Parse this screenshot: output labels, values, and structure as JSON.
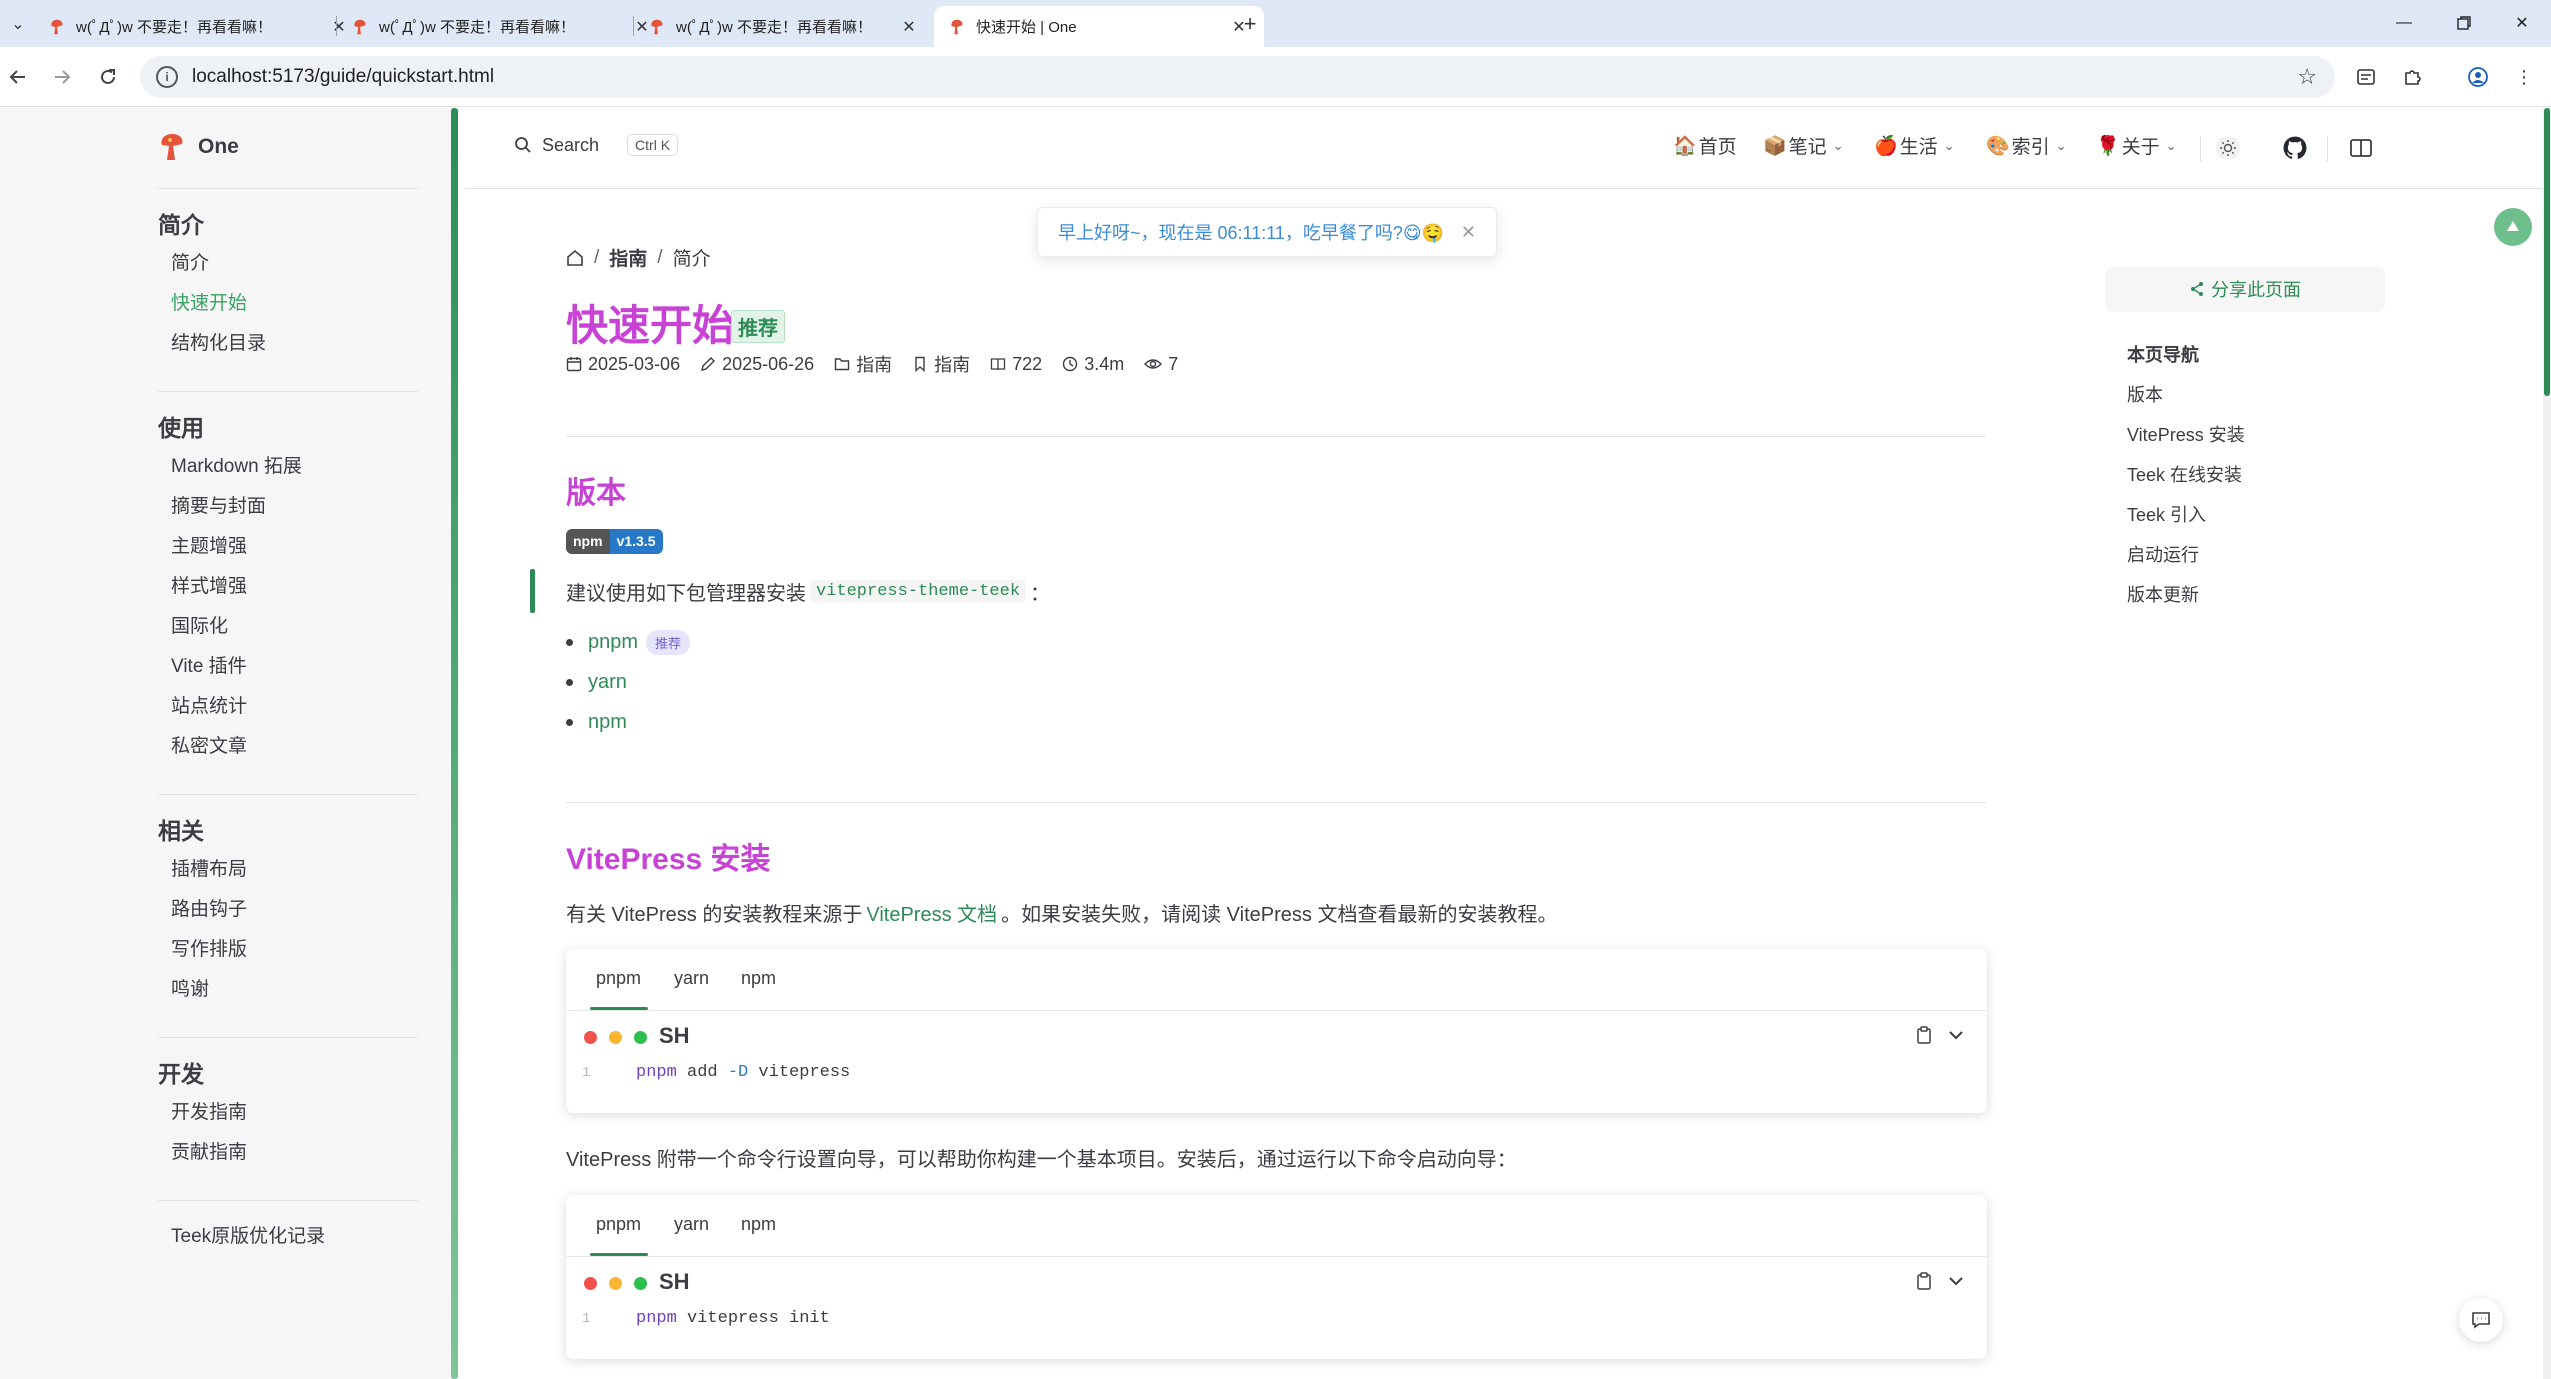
{
  "browser": {
    "tabs": [
      {
        "title": "w(ﾟДﾟ)w 不要走！再看看嘛！",
        "active": false
      },
      {
        "title": "w(ﾟДﾟ)w 不要走！再看看嘛！",
        "active": false
      },
      {
        "title": "w(ﾟДﾟ)w 不要走！再看看嘛！",
        "active": false
      },
      {
        "title": "快速开始 | One",
        "active": true
      }
    ],
    "url": "localhost:5173/guide/quickstart.html"
  },
  "site": {
    "name": "One",
    "search_label": "Search",
    "search_shortcut": "Ctrl K"
  },
  "navbar": {
    "items": [
      {
        "emoji": "🏠",
        "label": "首页",
        "dropdown": false
      },
      {
        "emoji": "📦",
        "label": "笔记",
        "dropdown": true
      },
      {
        "emoji": "🍎",
        "label": "生活",
        "dropdown": true
      },
      {
        "emoji": "🎨",
        "label": "索引",
        "dropdown": true
      },
      {
        "emoji": "🌹",
        "label": "关于",
        "dropdown": true
      }
    ]
  },
  "toast": {
    "message": "早上好呀~，现在是 06:11:11，吃早餐了吗?😋🤤"
  },
  "sidebar": {
    "groups": [
      {
        "title": "简介",
        "items": [
          "简介",
          "快速开始",
          "结构化目录"
        ],
        "active": "快速开始"
      },
      {
        "title": "使用",
        "items": [
          "Markdown 拓展",
          "摘要与封面",
          "主题增强",
          "样式增强",
          "国际化",
          "Vite 插件",
          "站点统计",
          "私密文章"
        ]
      },
      {
        "title": "相关",
        "items": [
          "插槽布局",
          "路由钩子",
          "写作排版",
          "鸣谢"
        ]
      },
      {
        "title": "开发",
        "items": [
          "开发指南",
          "贡献指南"
        ]
      }
    ],
    "extra_item": "Teek原版优化记录"
  },
  "breadcrumb": {
    "items": [
      "指南",
      "简介"
    ]
  },
  "article": {
    "title": "快速开始",
    "badge": "推荐",
    "meta": {
      "created": "2025-03-06",
      "updated": "2025-06-26",
      "category": "指南",
      "tag": "指南",
      "word_count": "722",
      "reading_time": "3.4m",
      "views": "7"
    },
    "section_version": {
      "heading": "版本",
      "npm_badge_left": "npm",
      "npm_badge_right": "v1.3.5",
      "intro_before": "建议使用如下包管理器安装",
      "intro_code": "vitepress-theme-teek",
      "intro_after": "：",
      "managers": [
        {
          "name": "pnpm",
          "tag": "推荐"
        },
        {
          "name": "yarn",
          "tag": ""
        },
        {
          "name": "npm",
          "tag": ""
        }
      ]
    },
    "section_install": {
      "heading": "VitePress 安装",
      "intro_before": "有关 VitePress 的安装教程来源于",
      "intro_link": "VitePress 文档",
      "intro_after": "。如果安装失败，请阅读 VitePress 文档查看最新的安装教程。",
      "code_block_1": {
        "tabs": [
          "pnpm",
          "yarn",
          "npm"
        ],
        "active_tab": "pnpm",
        "lang": "SH",
        "line_number": "1",
        "cmd": "pnpm",
        "rest_1": " add ",
        "flag": "-D",
        "rest_2": " vitepress"
      },
      "wizard_text": "VitePress 附带一个命令行设置向导，可以帮助你构建一个基本项目。安装后，通过运行以下命令启动向导：",
      "code_block_2": {
        "tabs": [
          "pnpm",
          "yarn",
          "npm"
        ],
        "active_tab": "pnpm",
        "lang": "SH",
        "line_number": "1",
        "cmd": "pnpm",
        "rest": " vitepress init"
      }
    }
  },
  "aside": {
    "share_label": "分享此页面",
    "toc_title": "本页导航",
    "toc_items": [
      "版本",
      "VitePress 安装",
      "Teek 在线安装",
      "Teek 引入",
      "启动运行",
      "版本更新"
    ]
  },
  "colors": {
    "brand": "#2e8b57",
    "heading": "#c842d6",
    "toast_text": "#3b8cd6"
  }
}
